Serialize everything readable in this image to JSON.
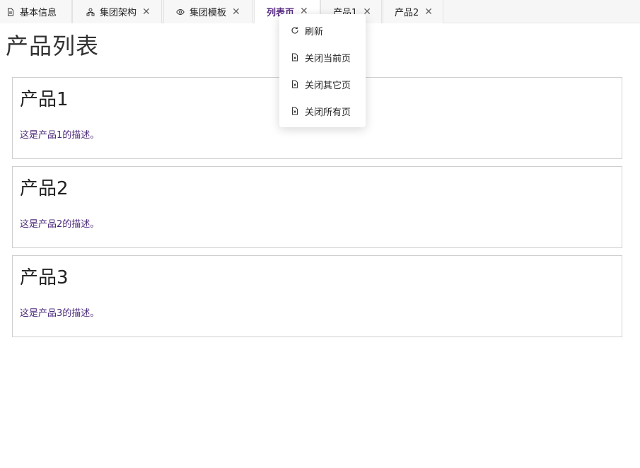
{
  "tabs": [
    {
      "label": "基本信息",
      "icon": "document-icon",
      "closable": false
    },
    {
      "label": "集团架构",
      "icon": "org-chart-icon",
      "closable": true
    },
    {
      "label": "集团模板",
      "icon": "eye-icon",
      "closable": true
    },
    {
      "label": "列表页",
      "icon": null,
      "closable": true,
      "active": true
    },
    {
      "label": "产品1",
      "icon": null,
      "closable": true
    },
    {
      "label": "产品2",
      "icon": null,
      "closable": true
    }
  ],
  "close_glyph": "✕",
  "page": {
    "title": "产品列表"
  },
  "products": [
    {
      "title": "产品1",
      "desc": "这是产品1的描述。"
    },
    {
      "title": "产品2",
      "desc": "这是产品2的描述。"
    },
    {
      "title": "产品3",
      "desc": "这是产品3的描述。"
    }
  ],
  "context_menu": {
    "items": [
      {
        "label": "刷新",
        "icon": "refresh-icon"
      },
      {
        "label": "关闭当前页",
        "icon": "close-page-icon"
      },
      {
        "label": "关闭其它页",
        "icon": "close-other-pages-icon"
      },
      {
        "label": "关闭所有页",
        "icon": "close-all-pages-icon"
      }
    ]
  },
  "colors": {
    "accent": "#5b2e86",
    "description": "#4b2a7a",
    "tabbar_bg": "#f6f6f6"
  }
}
